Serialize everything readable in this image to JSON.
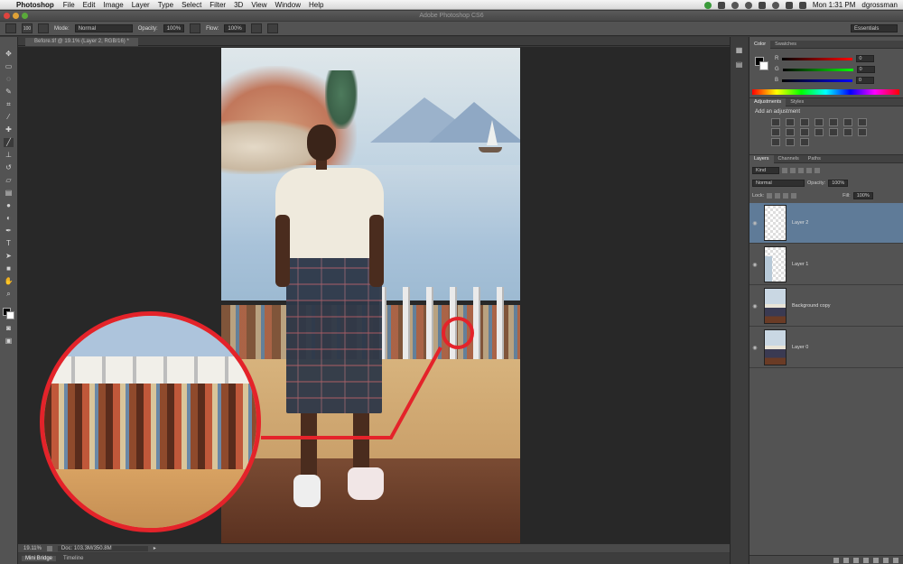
{
  "menubar": {
    "app_name": "Photoshop",
    "items": [
      "File",
      "Edit",
      "Image",
      "Layer",
      "Type",
      "Select",
      "Filter",
      "3D",
      "View",
      "Window",
      "Help"
    ],
    "clock": "Mon 1:31 PM",
    "user": "dgrossman"
  },
  "window": {
    "title": "Adobe Photoshop CS6"
  },
  "options": {
    "brush_size": "100",
    "mode_label": "Mode:",
    "mode_value": "Normal",
    "opacity_label": "Opacity:",
    "opacity_value": "100%",
    "flow_label": "Flow:",
    "flow_value": "100%",
    "workspace": "Essentials"
  },
  "document": {
    "tab_title": "Before.tif @ 19.1% (Layer 2, RGB/16) *"
  },
  "color_panel": {
    "tabs": [
      "Color",
      "Swatches"
    ],
    "channels": [
      {
        "label": "R",
        "value": "0"
      },
      {
        "label": "G",
        "value": "0"
      },
      {
        "label": "B",
        "value": "0"
      }
    ]
  },
  "adjustments_panel": {
    "tabs": [
      "Adjustments",
      "Styles"
    ],
    "prompt": "Add an adjustment"
  },
  "layers_panel": {
    "tabs": [
      "Layers",
      "Channels",
      "Paths"
    ],
    "filter_kind": "Kind",
    "blend_mode": "Normal",
    "opacity_label": "Opacity:",
    "opacity_value": "100%",
    "lock_label": "Lock:",
    "fill_label": "Fill:",
    "fill_value": "100%",
    "layers": [
      {
        "name": "Layer 2",
        "selected": true
      },
      {
        "name": "Layer 1",
        "selected": false
      },
      {
        "name": "Background copy",
        "selected": false
      },
      {
        "name": "Layer 0",
        "selected": false
      }
    ]
  },
  "statusbar": {
    "zoom": "19.11%",
    "doc_info": "Doc: 103.3M/350.8M"
  },
  "bottom_tabs": [
    "Mini Bridge",
    "Timeline"
  ],
  "colors": {
    "accent_red": "#e4232a",
    "selected_layer": "#5f7b98"
  }
}
